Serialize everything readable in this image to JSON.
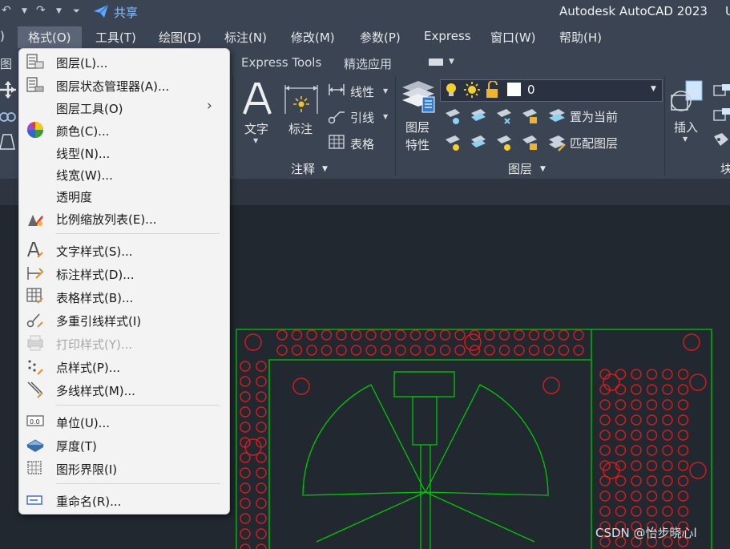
{
  "titlebar": {
    "share_label": "共享",
    "app_title": "Autodesk AutoCAD 2023",
    "title_extra": "U"
  },
  "menubar": {
    "items": [
      "格式(O)",
      "工具(T)",
      "绘图(D)",
      "标注(N)",
      "修改(M)",
      "参数(P)",
      "Express",
      "窗口(W)",
      "帮助(H)"
    ],
    "left_fragment": ")"
  },
  "ribbon_tabs": {
    "left_fragment": "图",
    "items": [
      "Express Tools",
      "精选应用"
    ]
  },
  "ribbon": {
    "text_label": "文字",
    "dim_label": "标注",
    "linear_label": "线性",
    "leader_label": "引线",
    "table_label": "表格",
    "annot_panel_title": "注释",
    "layer_props_line1": "图层",
    "layer_props_line2": "特性",
    "layer_combo_value": "0",
    "set_current_label": "置为当前",
    "match_layer_label": "匹配图层",
    "layer_panel_title": "图层",
    "insert_label": "插入",
    "block_panel_fragment": "块"
  },
  "format_menu": {
    "items": [
      {
        "label": "图层(L)...",
        "icon": "layers-icon",
        "enabled": true
      },
      {
        "label": "图层状态管理器(A)...",
        "icon": "layer-state-icon",
        "enabled": true
      },
      {
        "label": "图层工具(O)",
        "icon": "",
        "enabled": true,
        "submenu": true
      },
      {
        "label": "颜色(C)...",
        "icon": "color-wheel-icon",
        "enabled": true
      },
      {
        "label": "线型(N)...",
        "icon": "",
        "enabled": true
      },
      {
        "label": "线宽(W)...",
        "icon": "",
        "enabled": true
      },
      {
        "label": "透明度",
        "icon": "",
        "enabled": true
      },
      {
        "label": "比例缩放列表(E)...",
        "icon": "scale-list-icon",
        "enabled": true
      },
      {
        "label": "文字样式(S)...",
        "icon": "text-style-icon",
        "enabled": true
      },
      {
        "label": "标注样式(D)...",
        "icon": "dim-style-icon",
        "enabled": true
      },
      {
        "label": "表格样式(B)...",
        "icon": "table-style-icon",
        "enabled": true
      },
      {
        "label": "多重引线样式(I)",
        "icon": "mleader-style-icon",
        "enabled": true
      },
      {
        "label": "打印样式(Y)...",
        "icon": "plot-style-icon",
        "enabled": false
      },
      {
        "label": "点样式(P)...",
        "icon": "point-style-icon",
        "enabled": true
      },
      {
        "label": "多线样式(M)...",
        "icon": "mline-style-icon",
        "enabled": true
      },
      {
        "label": "单位(U)...",
        "icon": "units-icon",
        "enabled": true
      },
      {
        "label": "厚度(T)",
        "icon": "thickness-icon",
        "enabled": true
      },
      {
        "label": "图形界限(I)",
        "icon": "limits-icon",
        "enabled": true
      },
      {
        "label": "重命名(R)...",
        "icon": "rename-icon",
        "enabled": true
      }
    ],
    "submenu_arrow": "›"
  },
  "watermark": "CSDN @怡步晓心l",
  "colors": {
    "chrome_bg": "#3b4453",
    "viewport_bg": "#212830",
    "drawing_green": "#00c800",
    "drawing_red": "#d41e1e",
    "menu_bg": "#f3f3f3"
  }
}
